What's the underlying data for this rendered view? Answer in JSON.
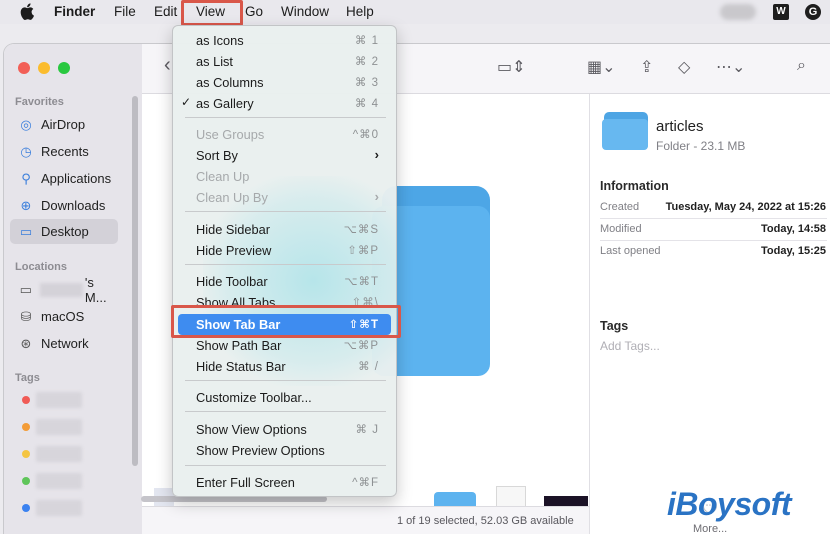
{
  "menubar": {
    "app_name": "Finder",
    "items": [
      "File",
      "Edit",
      "View",
      "Go",
      "Window",
      "Help"
    ],
    "extras": {
      "w_icon_label": "W",
      "g_icon_label": "G"
    }
  },
  "view_menu": {
    "items": [
      {
        "label": "as Icons",
        "shortcut": "⌘ 1",
        "enabled": true,
        "checked": false
      },
      {
        "label": "as List",
        "shortcut": "⌘ 2",
        "enabled": true,
        "checked": false
      },
      {
        "label": "as Columns",
        "shortcut": "⌘ 3",
        "enabled": true,
        "checked": false
      },
      {
        "label": "as Gallery",
        "shortcut": "⌘ 4",
        "enabled": true,
        "checked": true
      },
      {
        "label": "Use Groups",
        "shortcut": "^⌘0",
        "enabled": false
      },
      {
        "label": "Sort By",
        "submenu": true,
        "enabled": true
      },
      {
        "label": "Clean Up",
        "enabled": false
      },
      {
        "label": "Clean Up By",
        "submenu": true,
        "enabled": false
      },
      {
        "label": "Hide Sidebar",
        "shortcut": "⌥⌘S",
        "enabled": true
      },
      {
        "label": "Hide Preview",
        "shortcut": "⇧⌘P",
        "enabled": true
      },
      {
        "label": "Hide Toolbar",
        "shortcut": "⌥⌘T",
        "enabled": true
      },
      {
        "label": "Show All Tabs",
        "shortcut": "⇧⌘\\",
        "enabled": true
      },
      {
        "label": "Show Tab Bar",
        "shortcut": "⇧⌘T",
        "enabled": true,
        "highlighted": true
      },
      {
        "label": "Show Path Bar",
        "shortcut": "⌥⌘P",
        "enabled": true
      },
      {
        "label": "Hide Status Bar",
        "shortcut": "⌘ /",
        "enabled": true
      },
      {
        "label": "Customize Toolbar...",
        "enabled": true
      },
      {
        "label": "Show View Options",
        "shortcut": "⌘ J",
        "enabled": true
      },
      {
        "label": "Show Preview Options",
        "enabled": true
      },
      {
        "label": "Enter Full Screen",
        "shortcut": "^⌘F",
        "enabled": true
      }
    ]
  },
  "sidebar": {
    "favorites_header": "Favorites",
    "favorites": [
      "AirDrop",
      "Recents",
      "Applications",
      "Downloads",
      "Desktop"
    ],
    "active": "Desktop",
    "locations_header": "Locations",
    "locations": [
      "'s M...",
      "macOS",
      "Network"
    ],
    "tags_header": "Tags",
    "tag_colors": [
      "#f05b56",
      "#f39c38",
      "#f4c543",
      "#5fc55a",
      "#3b82f0"
    ]
  },
  "inspector": {
    "name": "articles",
    "kind": "Folder - 23.1 MB",
    "info_header": "Information",
    "rows": [
      {
        "key": "Created",
        "value": "Tuesday, May 24, 2022 at 15:26"
      },
      {
        "key": "Modified",
        "value": "Today, 14:58"
      },
      {
        "key": "Last opened",
        "value": "Today, 15:25"
      }
    ],
    "tags_header": "Tags",
    "add_tags_placeholder": "Add Tags...",
    "more_label": "More..."
  },
  "status": {
    "text": "1 of 19 selected, 52.03 GB available"
  },
  "watermark": "iBoysoft",
  "colors": {
    "highlight": "#3e8cf0",
    "annotation_box": "#d9574a",
    "folder": "#5cb3ef"
  }
}
